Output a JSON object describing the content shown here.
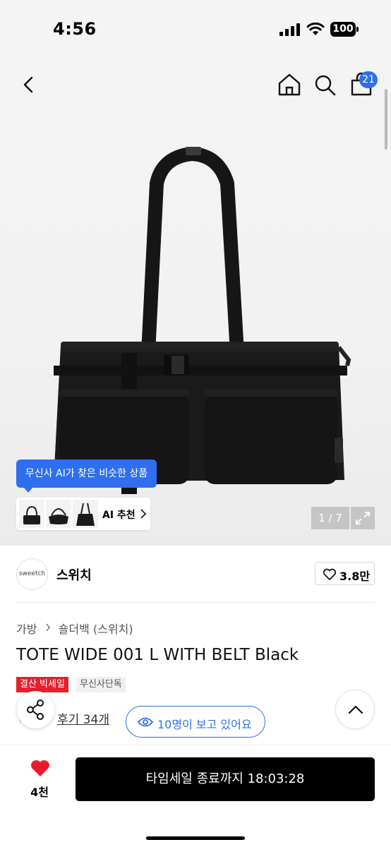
{
  "status_bar": {
    "time": "4:56",
    "battery": "100"
  },
  "nav": {
    "cart_count": "21"
  },
  "gallery": {
    "page_counter": "1 / 7",
    "ai_tooltip": "무신사 AI가 찾은 비슷한 상품",
    "ai_recommend_label": "AI 추천"
  },
  "brand": {
    "logo_text": "sweetch",
    "name": "스위치",
    "like_count": "3.8만"
  },
  "product": {
    "breadcrumb": [
      "가방",
      "숄더백 (스위치)"
    ],
    "title": "TOTE WIDE 001 L WITH BELT Black",
    "badges": {
      "sale": "결산 빅세일",
      "exclusive": "무신사단독"
    },
    "review_link": "후기 34개",
    "viewers": "10명이 보고 있어요"
  },
  "bottom_bar": {
    "wish_count": "4천",
    "buy_label": "타임세일 종료까지 18:03:28"
  },
  "colors": {
    "accent": "#2f6fef",
    "sale": "#e81e2c",
    "heart": "#e8192c"
  }
}
